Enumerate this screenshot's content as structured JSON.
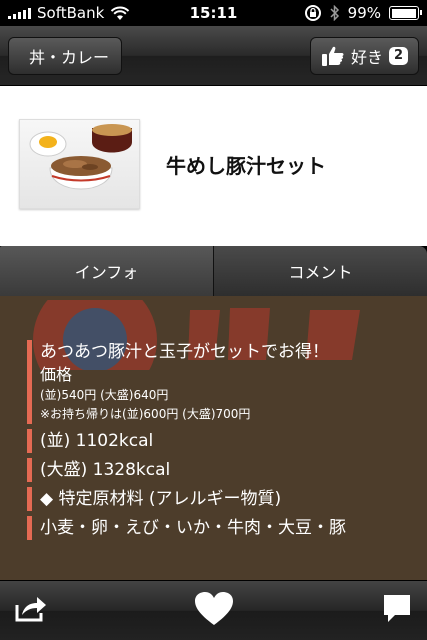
{
  "status_bar": {
    "carrier": "SoftBank",
    "time": "15:11",
    "battery_percent": "99%",
    "battery_level": 0.99
  },
  "nav": {
    "back_label": "丼・カレー",
    "like_label": "好き",
    "like_count": "2"
  },
  "item": {
    "title": "牛めし豚汁セット"
  },
  "tabs": [
    {
      "label": "インフォ",
      "active": true
    },
    {
      "label": "コメント",
      "active": false
    }
  ],
  "info": {
    "headline": "あつあつ豚汁と玉子がセットでお得！",
    "price_heading": "価格",
    "price_line1": "(並)540円 (大盛)640円",
    "price_line2": "※お持ち帰りは(並)600円 (大盛)700円",
    "kcal_regular": "(並) 1102kcal",
    "kcal_large": "(大盛) 1328kcal",
    "allergen_heading": "◆ 特定原材料 (アレルギー物質)",
    "allergens": "小麦・卵・えび・いか・牛肉・大豆・豚"
  },
  "colors": {
    "accent_bar": "#e56a53",
    "content_bg": "#4d3d2b"
  },
  "icons": [
    "signal-icon",
    "wifi-icon",
    "rotation-lock-icon",
    "bluetooth-icon",
    "battery-icon",
    "thumbs-up-icon",
    "share-icon",
    "heart-icon",
    "comment-icon"
  ]
}
